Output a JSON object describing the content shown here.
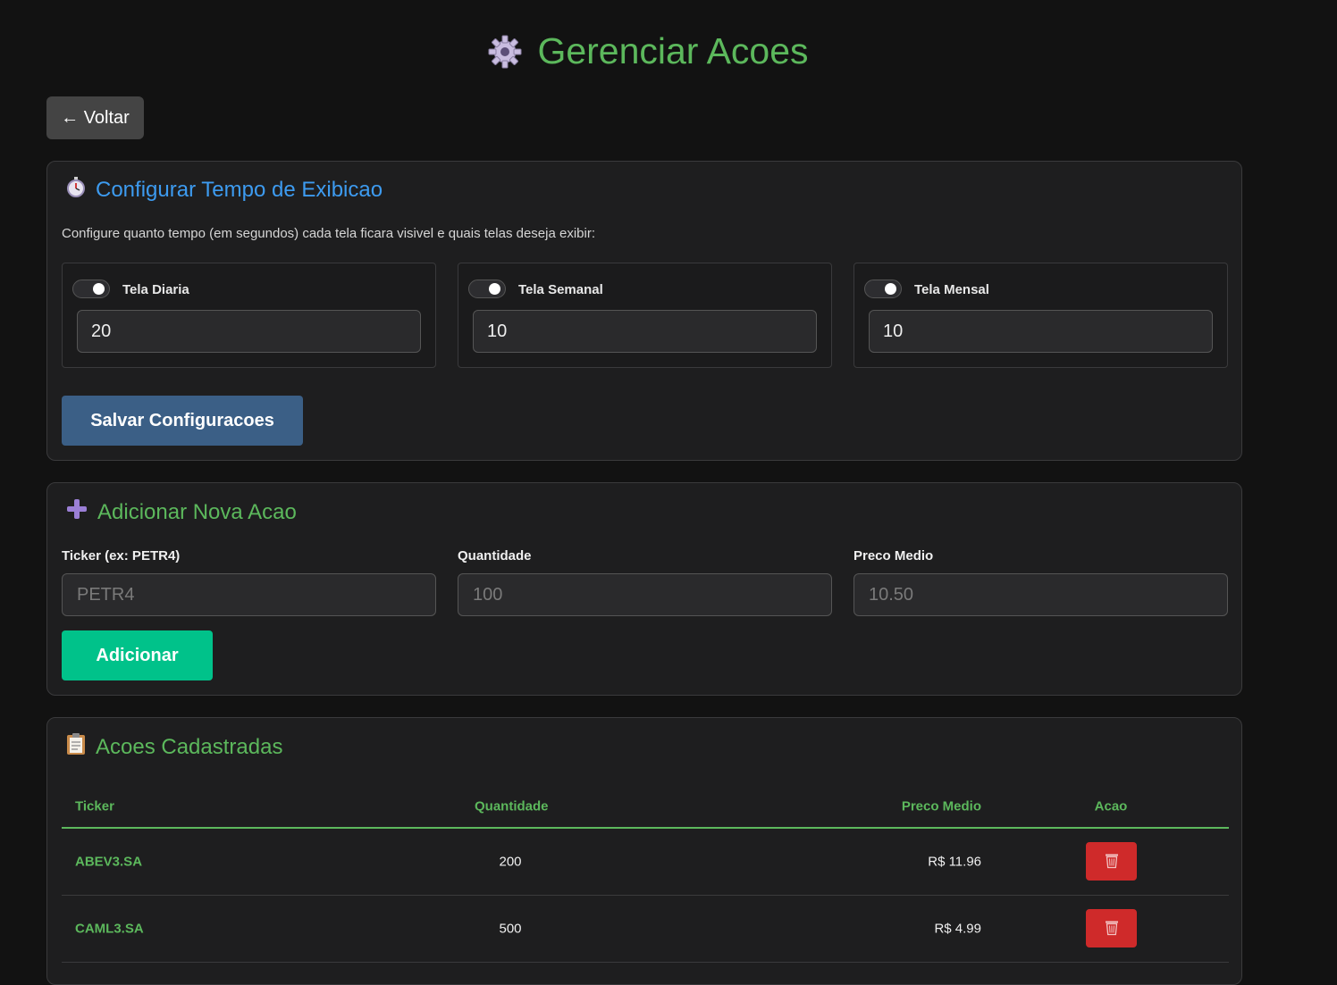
{
  "header": {
    "title": "Gerenciar Acoes",
    "icon": "gear-icon"
  },
  "back_button": {
    "label": "← Voltar"
  },
  "config": {
    "title": "Configurar Tempo de Exibicao",
    "icon": "stopwatch-icon",
    "description": "Configure quanto tempo (em segundos) cada tela ficara visivel e quais telas deseja exibir:",
    "screens": [
      {
        "label": "Tela Diaria",
        "enabled": true,
        "value": "20"
      },
      {
        "label": "Tela Semanal",
        "enabled": true,
        "value": "10"
      },
      {
        "label": "Tela Mensal",
        "enabled": true,
        "value": "10"
      }
    ],
    "save_label": "Salvar Configuracoes"
  },
  "add": {
    "title": "Adicionar Nova Acao",
    "icon": "plus-icon",
    "fields": [
      {
        "label": "Ticker (ex: PETR4)",
        "placeholder": "PETR4"
      },
      {
        "label": "Quantidade",
        "placeholder": "100"
      },
      {
        "label": "Preco Medio",
        "placeholder": "10.50"
      }
    ],
    "add_label": "Adicionar"
  },
  "list": {
    "title": "Acoes Cadastradas",
    "icon": "clipboard-icon",
    "columns": [
      "Ticker",
      "Quantidade",
      "Preco Medio",
      "Acao"
    ],
    "rows": [
      {
        "ticker": "ABEV3.SA",
        "quantity": "200",
        "price": "R$ 11.96"
      },
      {
        "ticker": "CAML3.SA",
        "quantity": "500",
        "price": "R$ 4.99"
      }
    ]
  },
  "colors": {
    "background": "#121212",
    "accent_green": "#5cb85c",
    "accent_blue": "#3d9bf0",
    "save_button": "#3b5f86",
    "add_button": "#00c28a",
    "delete_button": "#cf2a2a"
  }
}
